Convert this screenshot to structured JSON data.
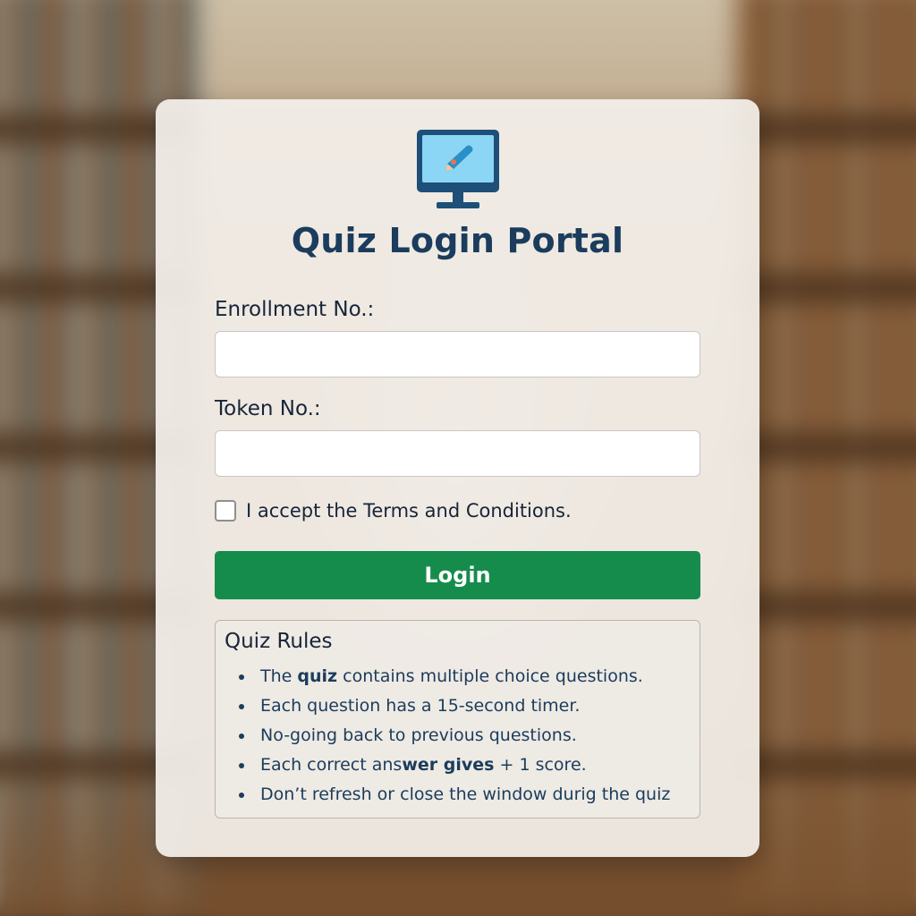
{
  "login_card": {
    "title": "Quiz Login Portal",
    "logo_icon": "computer-monitor-pencil-icon",
    "enrollment": {
      "label": "Enrollment No.:",
      "value": "",
      "placeholder": ""
    },
    "token": {
      "label": "Token No.:",
      "value": "",
      "placeholder": ""
    },
    "terms": {
      "label": "I accept the Terms and Conditions.",
      "checked": false
    },
    "login_button": {
      "label": "Login"
    }
  },
  "rules": {
    "title": "Quiz Rules",
    "items": [
      {
        "parts": [
          "The ",
          "quiz",
          " contains multiple choice questions."
        ]
      },
      {
        "parts": [
          "Each question has a 15-second timer."
        ]
      },
      {
        "parts": [
          "No-going back to previous questions."
        ]
      },
      {
        "parts": [
          "Each correct ans",
          "wer gives",
          " + 1 score."
        ]
      },
      {
        "parts": [
          "Don’t refresh or close the window durig the quiz"
        ]
      }
    ]
  },
  "colors": {
    "title": "#1b3c5c",
    "button": "#168c4c",
    "text": "#172538"
  }
}
